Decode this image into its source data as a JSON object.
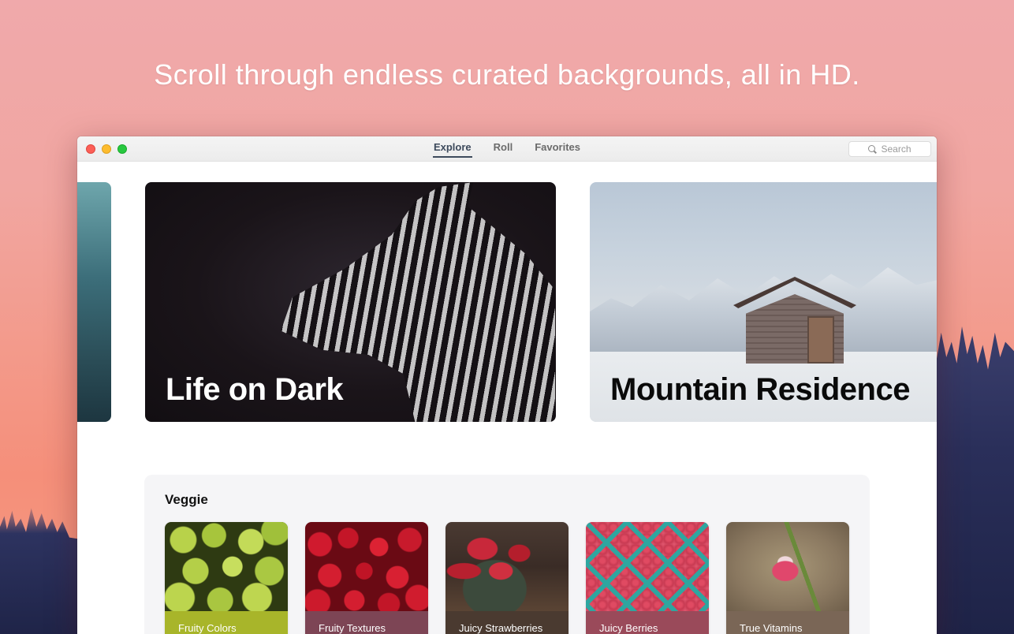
{
  "headline": "Scroll through endless curated backgrounds, all in HD.",
  "window": {
    "tabs": [
      {
        "label": "Explore",
        "active": true
      },
      {
        "label": "Roll",
        "active": false
      },
      {
        "label": "Favorites",
        "active": false
      }
    ],
    "search": {
      "placeholder": "Search"
    }
  },
  "heroes": [
    {
      "title": "Life on Dark",
      "theme": "dark"
    },
    {
      "title": "Mountain Residence",
      "theme": "light"
    }
  ],
  "section": {
    "title": "Veggie",
    "cards": [
      {
        "label": "Fruity Colors",
        "color": "#a8b52a"
      },
      {
        "label": "Fruity Textures",
        "color": "#7d4555"
      },
      {
        "label": "Juicy Strawberries",
        "color": "#4a3a30"
      },
      {
        "label": "Juicy Berries",
        "color": "#9a4a5a"
      },
      {
        "label": "True Vitamins",
        "color": "#7a6656"
      }
    ]
  },
  "colors": {
    "accent": "#3d4a5c",
    "background_top": "#f0a9ab",
    "background_bottom": "#f58f7a"
  }
}
